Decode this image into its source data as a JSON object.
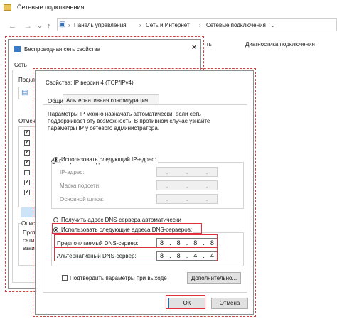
{
  "explorer": {
    "title": "Сетевые подключения",
    "breadcrumb": [
      "Панель управления",
      "Сеть и Интернет",
      "Сетевые подключения"
    ],
    "cmd1": "ть",
    "cmd2": "Диагностика подключения"
  },
  "props": {
    "title": "Беспроводная сеть свойства",
    "tab": "Сеть",
    "connect_label": "Подключ",
    "components_label": "Отмеченные компоненты используются",
    "desc_label": "Описание",
    "desc_text": "Прото\nсети,\nвзаим"
  },
  "ipv4": {
    "title": "Свойства: IP версии 4 (TCP/IPv4)",
    "tabs": [
      "Общие",
      "Альтернативная конфигурация"
    ],
    "description": "Параметры IP можно назначать автоматически, если сеть поддерживает эту возможность. В противном случае узнайте параметры IP у сетевого администратора.",
    "auto_ip": "Получить IP-адрес автоматически",
    "manual_ip": "Использовать следующий IP-адрес:",
    "ip_label": "IP-адрес:",
    "mask_label": "Маска подсети:",
    "gateway_label": "Основной шлюз:",
    "auto_dns": "Получить адрес DNS-сервера автоматически",
    "manual_dns": "Использовать следующие адреса DNS-серверов:",
    "pref_dns_label": "Предпочитаемый DNS-сервер:",
    "alt_dns_label": "Альтернативный DNS-сервер:",
    "pref_dns": [
      "8",
      "8",
      "8",
      "8"
    ],
    "alt_dns": [
      "8",
      "8",
      "4",
      "4"
    ],
    "validate": "Подтвердить параметры при выходе",
    "advanced": "Дополнительно...",
    "ok": "ОК",
    "cancel": "Отмена"
  },
  "colors": {
    "highlight": "#e0303c",
    "background": "#ffffff"
  }
}
